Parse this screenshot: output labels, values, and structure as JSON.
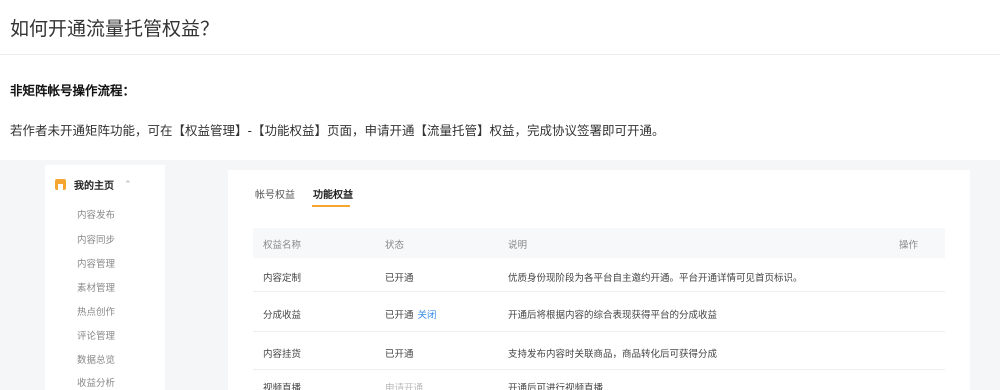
{
  "page_title": "如何开通流量托管权益？",
  "section_heading": "非矩阵帐号操作流程：",
  "intro_text": "若作者未开通矩阵功能，可在【权益管理】-【功能权益】页面，申请开通【流量托管】权益，完成协议签署即可开通。",
  "sidebar": {
    "home_label": "我的主页",
    "chevron": "⌃",
    "items": [
      "内容发布",
      "内容同步",
      "内容管理",
      "素材管理",
      "热点创作",
      "评论管理",
      "数据总览",
      "收益分析"
    ]
  },
  "tabs": [
    "帐号权益",
    "功能权益"
  ],
  "table": {
    "headers": [
      "权益名称",
      "状态",
      "说明",
      "操作"
    ],
    "rows": [
      {
        "name": "内容定制",
        "status": "已开通",
        "status_link": "",
        "desc": "优质身份现阶段为各平台自主邀约开通。平台开通详情可见首页标识。"
      },
      {
        "name": "分成收益",
        "status": "已开通",
        "status_link": "关闭",
        "desc": "开通后将根据内容的综合表现获得平台的分成收益"
      },
      {
        "name": "内容挂货",
        "status": "已开通",
        "status_link": "",
        "desc": "支持发布内容时关联商品，商品转化后可获得分成"
      },
      {
        "name": "视频直播",
        "status": "申请开通",
        "status_link": "",
        "desc": "开通后可进行视频直播"
      }
    ]
  }
}
